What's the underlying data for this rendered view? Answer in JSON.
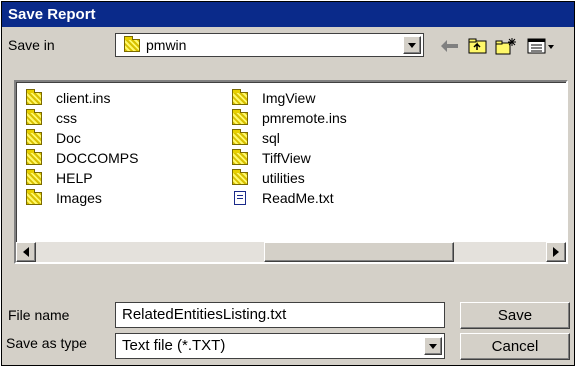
{
  "window": {
    "title": "Save Report"
  },
  "save_in": {
    "label": "Save in",
    "value": "pmwin"
  },
  "toolbar": {
    "back_icon": "back-arrow-icon",
    "up_icon": "up-folder-icon",
    "new_folder_icon": "new-folder-icon",
    "view_menu_icon": "view-menu-icon"
  },
  "files": [
    {
      "name": "client.ins",
      "icon": "folder"
    },
    {
      "name": "css",
      "icon": "folder"
    },
    {
      "name": "Doc",
      "icon": "folder"
    },
    {
      "name": "DOCCOMPS",
      "icon": "folder"
    },
    {
      "name": "HELP",
      "icon": "folder"
    },
    {
      "name": "Images",
      "icon": "folder"
    },
    {
      "name": "ImgView",
      "icon": "folder"
    },
    {
      "name": "pmremote.ins",
      "icon": "folder"
    },
    {
      "name": "sql",
      "icon": "folder"
    },
    {
      "name": "TiffView",
      "icon": "folder"
    },
    {
      "name": "utilities",
      "icon": "folder"
    },
    {
      "name": "ReadMe.txt",
      "icon": "file"
    }
  ],
  "filename": {
    "label": "File name",
    "value": "RelatedEntitiesListing.txt"
  },
  "filetype": {
    "label": "Save as type",
    "value": "Text file (*.TXT)"
  },
  "buttons": {
    "save": "Save",
    "cancel": "Cancel"
  },
  "colors": {
    "titlebar": "#0a2a8a",
    "dialog_bg": "#d4d0c8",
    "folder": "#e8d000"
  }
}
